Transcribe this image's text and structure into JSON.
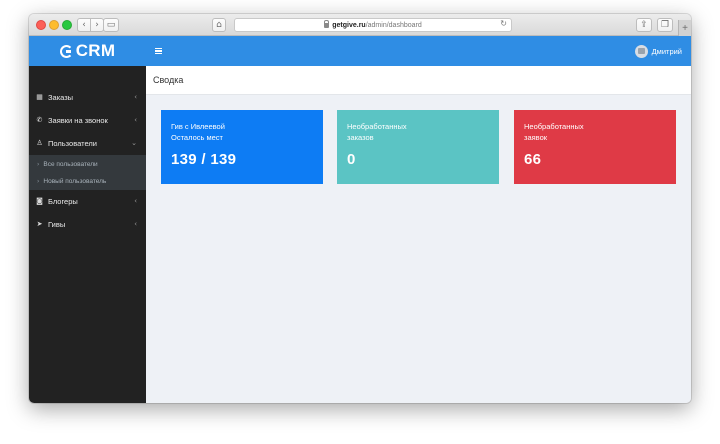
{
  "browser": {
    "url_domain": "getgive.ru",
    "url_path": "/admin/dashboard"
  },
  "header": {
    "logo": "CRM",
    "user_name": "Дмитрий"
  },
  "sidebar": {
    "items": [
      {
        "label": "Заказы",
        "icon": "grid-icon"
      },
      {
        "label": "Заявки на звонок",
        "icon": "phone-icon"
      },
      {
        "label": "Пользователи",
        "icon": "user-icon"
      },
      {
        "label": "Блогеры",
        "icon": "instagram-icon"
      },
      {
        "label": "Гивы",
        "icon": "send-icon"
      }
    ],
    "submenu": [
      {
        "label": "Все пользователи"
      },
      {
        "label": "Новый пользователь"
      }
    ]
  },
  "page": {
    "title": "Сводка"
  },
  "cards": [
    {
      "line1": "Гив с Ивлеевой",
      "line2": "Осталось мест",
      "value": "139 / 139",
      "color": "#0d7cf4"
    },
    {
      "line1": "Необработанных",
      "line2": "заказов",
      "value": "0",
      "color": "#5bc4c4"
    },
    {
      "line1": "Необработанных",
      "line2": "заявок",
      "value": "66",
      "color": "#df3a46"
    }
  ]
}
